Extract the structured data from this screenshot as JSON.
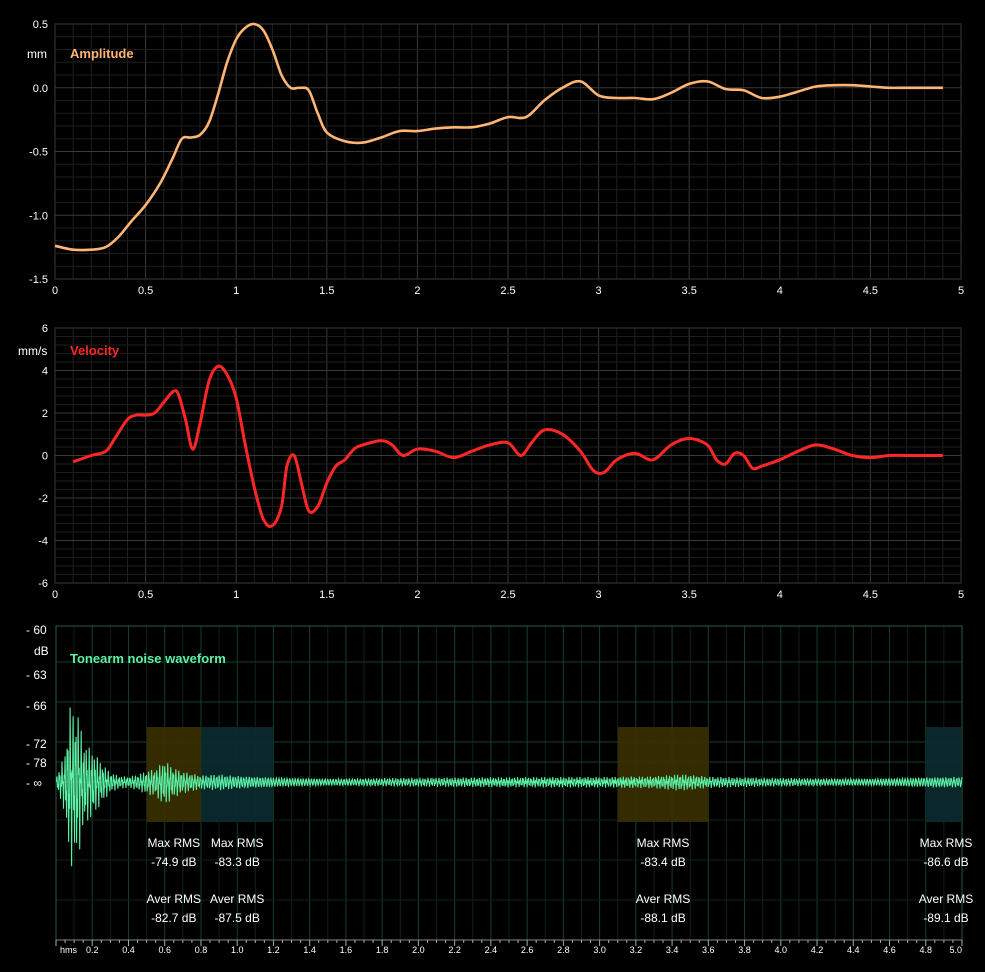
{
  "colors": {
    "background": "#000000",
    "grid_minor": "#1e1e1e",
    "grid_major": "#3a3a3a",
    "axis_text": "#ffffff",
    "amplitude": "#ffb574",
    "velocity": "#ff2626",
    "noise": "#5cf2a6",
    "noise_grid": "#103a22",
    "region_yellow": "#3a3000",
    "region_blue": "#0b2b31"
  },
  "chart_data": [
    {
      "type": "line",
      "title": "Amplitude",
      "ylabel": "mm",
      "xlim": [
        0,
        5
      ],
      "ylim": [
        -1.5,
        0.5
      ],
      "x_ticks": [
        "0",
        "0.5",
        "1",
        "1.5",
        "2",
        "2.5",
        "3",
        "3.5",
        "4",
        "4.5",
        "5"
      ],
      "y_ticks": [
        "0.5",
        "0.0",
        "-0.5",
        "-1.0",
        "-1.5"
      ],
      "series": [
        {
          "x": [
            0,
            0.1,
            0.2,
            0.28,
            0.35,
            0.42,
            0.5,
            0.58,
            0.65,
            0.7,
            0.75,
            0.8,
            0.85,
            0.9,
            0.95,
            1.0,
            1.05,
            1.1,
            1.15,
            1.2,
            1.25,
            1.3,
            1.35,
            1.4,
            1.45,
            1.5,
            1.6,
            1.7,
            1.8,
            1.9,
            2.0,
            2.1,
            2.2,
            2.3,
            2.4,
            2.5,
            2.6,
            2.7,
            2.8,
            2.9,
            3.0,
            3.1,
            3.2,
            3.3,
            3.4,
            3.5,
            3.6,
            3.7,
            3.8,
            3.9,
            4.0,
            4.1,
            4.2,
            4.3,
            4.4,
            4.5,
            4.6,
            4.7,
            4.8,
            4.9
          ],
          "y": [
            -1.24,
            -1.27,
            -1.27,
            -1.25,
            -1.17,
            -1.05,
            -0.92,
            -0.75,
            -0.55,
            -0.4,
            -0.39,
            -0.37,
            -0.27,
            -0.05,
            0.2,
            0.38,
            0.47,
            0.5,
            0.45,
            0.3,
            0.1,
            0.0,
            0.0,
            -0.02,
            -0.2,
            -0.35,
            -0.42,
            -0.43,
            -0.39,
            -0.34,
            -0.34,
            -0.32,
            -0.31,
            -0.31,
            -0.28,
            -0.23,
            -0.23,
            -0.1,
            0.0,
            0.05,
            -0.06,
            -0.08,
            -0.08,
            -0.09,
            -0.04,
            0.03,
            0.05,
            -0.01,
            -0.02,
            -0.08,
            -0.07,
            -0.03,
            0.01,
            0.02,
            0.02,
            0.01,
            0.0,
            0.0,
            0.0,
            0.0
          ]
        }
      ]
    },
    {
      "type": "line",
      "title": "Velocity",
      "ylabel": "mm/s",
      "xlim": [
        0,
        5
      ],
      "ylim": [
        -6,
        6
      ],
      "x_ticks": [
        "0",
        "0.5",
        "1",
        "1.5",
        "2",
        "2.5",
        "3",
        "3.5",
        "4",
        "4.5",
        "5"
      ],
      "y_ticks": [
        "6",
        "4",
        "2",
        "0",
        "-2",
        "-4",
        "-6"
      ],
      "series": [
        {
          "x": [
            0.1,
            0.2,
            0.28,
            0.33,
            0.4,
            0.45,
            0.5,
            0.55,
            0.6,
            0.65,
            0.68,
            0.72,
            0.76,
            0.8,
            0.85,
            0.9,
            0.95,
            1.0,
            1.05,
            1.1,
            1.15,
            1.2,
            1.25,
            1.28,
            1.32,
            1.36,
            1.4,
            1.45,
            1.5,
            1.55,
            1.6,
            1.65,
            1.7,
            1.8,
            1.86,
            1.92,
            2.0,
            2.1,
            2.2,
            2.3,
            2.4,
            2.5,
            2.57,
            2.63,
            2.7,
            2.8,
            2.9,
            2.97,
            3.03,
            3.1,
            3.2,
            3.3,
            3.4,
            3.5,
            3.6,
            3.65,
            3.7,
            3.75,
            3.8,
            3.85,
            3.9,
            4.0,
            4.1,
            4.2,
            4.3,
            4.4,
            4.5,
            4.6,
            4.7,
            4.8,
            4.9
          ],
          "y": [
            -0.3,
            0.0,
            0.2,
            0.8,
            1.7,
            1.9,
            1.9,
            2.0,
            2.5,
            3.0,
            2.9,
            1.7,
            0.3,
            1.5,
            3.5,
            4.2,
            3.8,
            2.7,
            0.5,
            -1.5,
            -3.0,
            -3.3,
            -2.4,
            -0.5,
            0.0,
            -1.3,
            -2.6,
            -2.4,
            -1.3,
            -0.5,
            -0.2,
            0.3,
            0.5,
            0.7,
            0.5,
            0.0,
            0.3,
            0.2,
            -0.1,
            0.2,
            0.5,
            0.6,
            0.0,
            0.6,
            1.2,
            1.0,
            0.2,
            -0.7,
            -0.8,
            -0.2,
            0.1,
            -0.2,
            0.5,
            0.8,
            0.5,
            -0.2,
            -0.4,
            0.1,
            0.0,
            -0.6,
            -0.5,
            -0.2,
            0.2,
            0.5,
            0.3,
            0.0,
            -0.1,
            0.0,
            0.0,
            0.0,
            0.0
          ]
        }
      ]
    },
    {
      "type": "line",
      "title": "Tonearm noise waveform",
      "ylabel": "dB",
      "xlim": [
        0,
        5
      ],
      "x_axis_label": "hms",
      "x_ticks": [
        "0.2",
        "0.4",
        "0.6",
        "0.8",
        "1.0",
        "1.2",
        "1.4",
        "1.6",
        "1.8",
        "2.0",
        "2.2",
        "2.4",
        "2.6",
        "2.8",
        "3.0",
        "3.2",
        "3.4",
        "3.6",
        "3.8",
        "4.0",
        "4.2",
        "4.4",
        "4.6",
        "4.8",
        "5.0"
      ],
      "y_ticks": [
        "- 60",
        "- 63",
        "- 66",
        "- 72",
        "- 78",
        "- ∞"
      ],
      "envelope": {
        "x": [
          0,
          0.05,
          0.08,
          0.1,
          0.12,
          0.15,
          0.2,
          0.25,
          0.3,
          0.35,
          0.4,
          0.45,
          0.5,
          0.55,
          0.6,
          0.65,
          0.7,
          0.8,
          0.9,
          1.0,
          1.2,
          1.5,
          2.0,
          2.5,
          3.0,
          3.3,
          3.45,
          3.6,
          3.9,
          4.2,
          4.5,
          4.8,
          5.0
        ],
        "amplitude": [
          0.05,
          0.35,
          1.0,
          0.8,
          0.9,
          0.5,
          0.4,
          0.25,
          0.12,
          0.08,
          0.07,
          0.1,
          0.15,
          0.18,
          0.3,
          0.2,
          0.15,
          0.1,
          0.12,
          0.1,
          0.08,
          0.06,
          0.06,
          0.06,
          0.06,
          0.07,
          0.1,
          0.07,
          0.06,
          0.06,
          0.06,
          0.08,
          0.08
        ]
      },
      "regions": [
        {
          "start": 0.5,
          "end": 0.8,
          "color": "yellow",
          "max_label": "Max RMS",
          "max_value": "-74.9 dB",
          "aver_label": "Aver RMS",
          "aver_value": "-82.7 dB"
        },
        {
          "start": 0.8,
          "end": 1.2,
          "color": "blue",
          "max_label": "Max RMS",
          "max_value": "-83.3 dB",
          "aver_label": "Aver RMS",
          "aver_value": "-87.5 dB"
        },
        {
          "start": 3.1,
          "end": 3.6,
          "color": "yellow",
          "max_label": "Max RMS",
          "max_value": "-83.4 dB",
          "aver_label": "Aver RMS",
          "aver_value": "-88.1 dB"
        },
        {
          "start": 4.8,
          "end": 5.0,
          "color": "blue",
          "max_label": "Max RMS",
          "max_value": "-86.6 dB",
          "aver_label": "Aver RMS",
          "aver_value": "-89.1 dB"
        }
      ]
    }
  ]
}
